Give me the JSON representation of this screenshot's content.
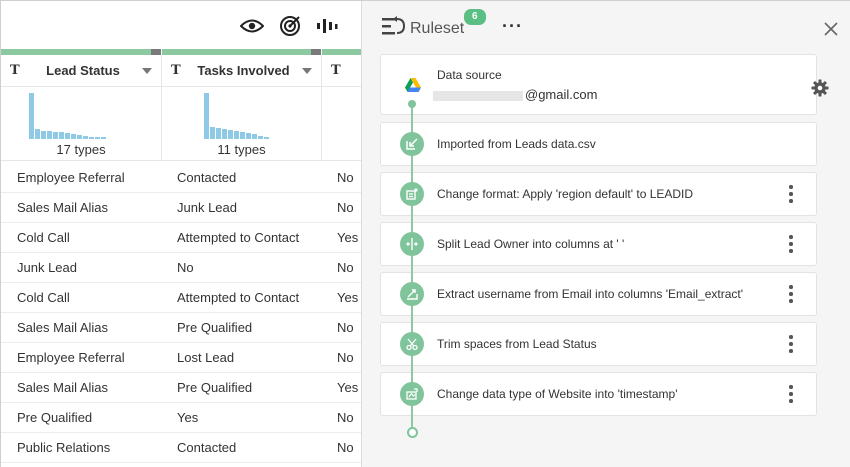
{
  "columns": [
    {
      "type_glyph": "T",
      "label": "Lead Status",
      "types": "17 types",
      "bars": [
        46,
        10,
        8,
        8,
        7,
        7,
        6,
        5,
        4,
        3,
        2,
        2,
        2
      ]
    },
    {
      "type_glyph": "T",
      "label": "Tasks Involved",
      "types": "11 types",
      "bars": [
        46,
        12,
        11,
        10,
        9,
        8,
        7,
        6,
        5,
        3,
        2
      ]
    },
    {
      "type_glyph": "T"
    }
  ],
  "rows": [
    [
      "Employee Referral",
      "Contacted",
      "No"
    ],
    [
      "Sales Mail Alias",
      "Junk Lead",
      "No"
    ],
    [
      "Cold Call",
      "Attempted to Contact",
      "Yes"
    ],
    [
      "Junk Lead",
      "No",
      "No"
    ],
    [
      "Cold Call",
      "Attempted to Contact",
      "Yes"
    ],
    [
      "Sales Mail Alias",
      "Pre Qualified",
      "No"
    ],
    [
      "Employee Referral",
      "Lost Lead",
      "No"
    ],
    [
      "Sales Mail Alias",
      "Pre Qualified",
      "Yes"
    ],
    [
      "Pre Qualified",
      "Yes",
      "No"
    ],
    [
      "Public Relations",
      "Contacted",
      "No"
    ]
  ],
  "ruleset": {
    "title": "Ruleset",
    "count": "6",
    "more": "···",
    "source_label": "Data source",
    "source_email": "@gmail.com",
    "steps": [
      "Imported from Leads data.csv",
      "Change format: Apply 'region default' to LEADID",
      "Split Lead Owner into columns at ' '",
      "Extract username from Email into columns 'Email_extract'",
      "Trim spaces from Lead Status",
      "Change data type of Website into 'timestamp'"
    ]
  },
  "colors": {
    "accent": "#7fc49a",
    "histogram": "#8ecae6",
    "badge": "#5bbf83"
  }
}
